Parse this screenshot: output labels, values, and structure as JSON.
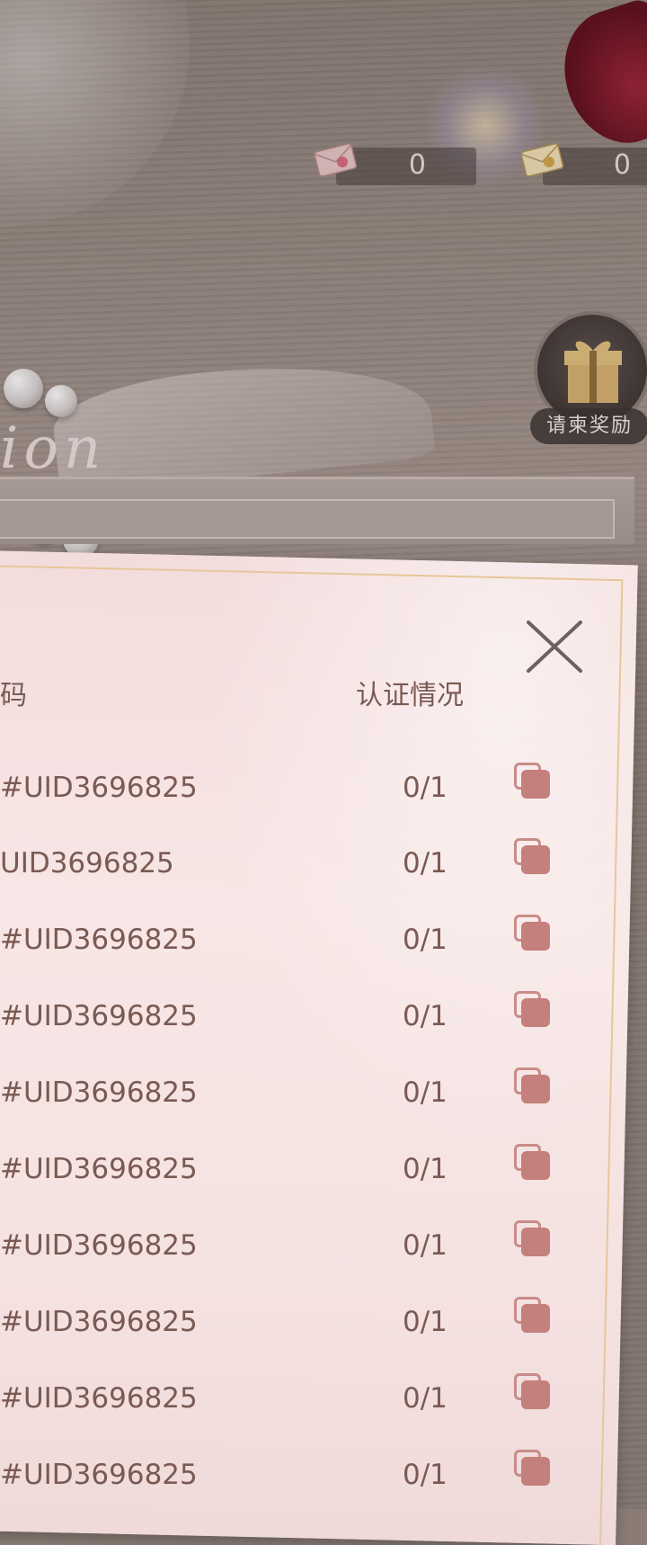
{
  "currencies": [
    {
      "name": "pink-letter",
      "value": "0"
    },
    {
      "name": "gold-letter",
      "value": "0"
    }
  ],
  "gift": {
    "label": "请柬奖励"
  },
  "background_text": "ion",
  "modal": {
    "header_left": "码",
    "header_right": "认证情况",
    "rows": [
      {
        "uid": "#UID3696825",
        "status": "0/1"
      },
      {
        "uid": "UID3696825",
        "status": "0/1"
      },
      {
        "uid": "#UID3696825",
        "status": "0/1"
      },
      {
        "uid": "#UID3696825",
        "status": "0/1"
      },
      {
        "uid": "#UID3696825",
        "status": "0/1"
      },
      {
        "uid": "#UID3696825",
        "status": "0/1"
      },
      {
        "uid": "#UID3696825",
        "status": "0/1"
      },
      {
        "uid": "#UID3696825",
        "status": "0/1"
      },
      {
        "uid": "#UID3696825",
        "status": "0/1"
      },
      {
        "uid": "#UID3696825",
        "status": "0/1"
      }
    ]
  },
  "colors": {
    "text": "#7a5a52",
    "copy_icon": "#c4807c",
    "card_border": "#e6c79a"
  }
}
